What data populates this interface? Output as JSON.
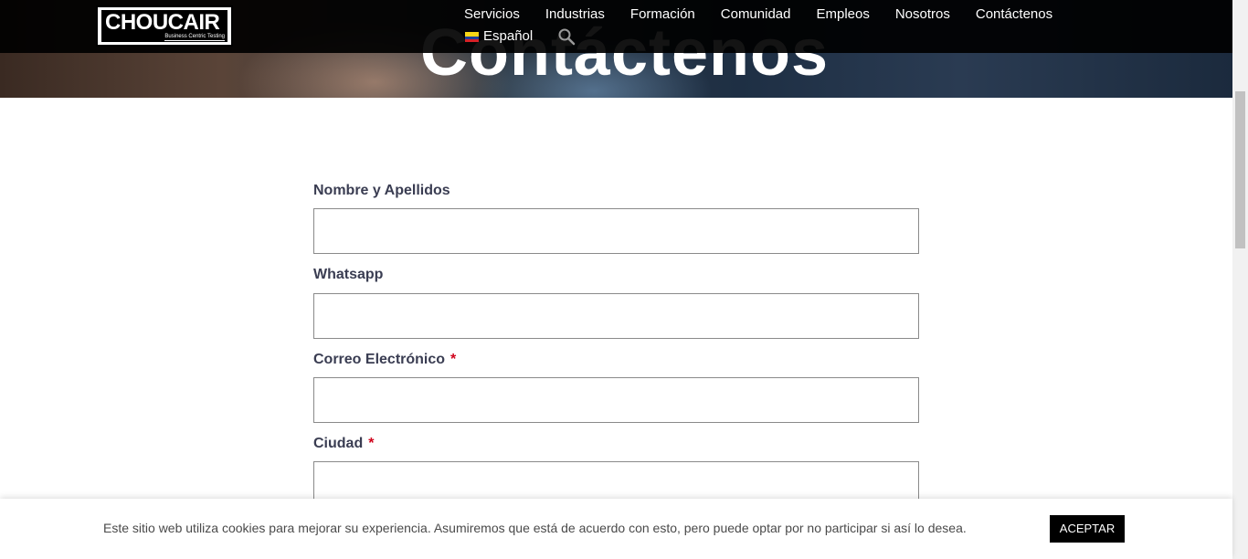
{
  "hero": {
    "title": "Contáctenos"
  },
  "brand": {
    "logo_text": "CHOUCAIR",
    "logo_tagline": "Business Centric Testing"
  },
  "nav": {
    "items": [
      {
        "label": "Servicios"
      },
      {
        "label": "Industrias"
      },
      {
        "label": "Formación"
      },
      {
        "label": "Comunidad"
      },
      {
        "label": "Empleos"
      },
      {
        "label": "Nosotros"
      },
      {
        "label": "Contáctenos"
      }
    ],
    "language": "Español",
    "language_flag_icon": "colombia-flag-icon",
    "search_icon": "search-icon"
  },
  "form": {
    "fields": [
      {
        "label": "Nombre y Apellidos",
        "required": false,
        "value": ""
      },
      {
        "label": "Whatsapp",
        "required": false,
        "value": ""
      },
      {
        "label": "Correo Electrónico",
        "required": true,
        "value": ""
      },
      {
        "label": "Ciudad",
        "required": true,
        "value": ""
      }
    ],
    "required_mark": "*"
  },
  "cookie": {
    "message": "Este sitio web utiliza cookies para mejorar su experiencia. Asumiremos que está de acuerdo con esto, pero puede optar por no participar si así lo desea.",
    "accept_label": "ACEPTAR"
  },
  "colors": {
    "navbar_bg": "#000000",
    "label_color": "#3a3d52",
    "required_color": "#d0021b",
    "button_bg": "#000000"
  }
}
